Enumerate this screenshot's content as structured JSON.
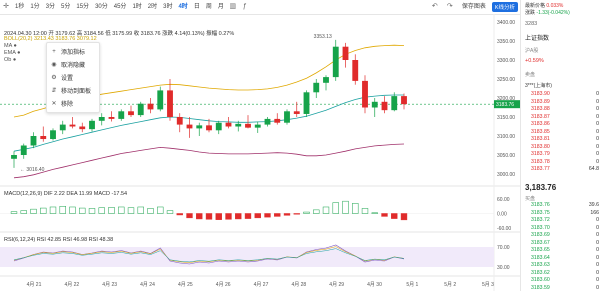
{
  "toolbar": {
    "timeframes": [
      "1秒",
      "1分",
      "3分",
      "5分",
      "15分",
      "30分",
      "45分",
      "1时",
      "2时",
      "3时",
      "4时",
      "日",
      "周",
      "月"
    ],
    "active_index": 10,
    "right_label": "保存图表",
    "badge": "K线分析"
  },
  "legend": {
    "line1": "2024.04.30 12:00  开 3179.62  高 3184.56  低 3175.99  收 3183.76  涨跌 4.14(0.13%)  振幅 0.27%",
    "line2": "BOLL(20,2)  3213.43  3183.76  3079.12"
  },
  "context_menu": {
    "items": [
      {
        "label": "添加指标",
        "icon": "plus-icon",
        "glyph": "+"
      },
      {
        "label": "取消隐藏",
        "icon": "eye-icon",
        "glyph": "◉"
      },
      {
        "label": "设置",
        "icon": "gear-icon",
        "glyph": "⚙"
      },
      {
        "label": "移动到面板",
        "icon": "move-icon",
        "glyph": "⇵"
      },
      {
        "label": "移除",
        "icon": "trash-icon",
        "glyph": "✕"
      }
    ]
  },
  "chart_labels": {
    "high_marker": "3353.13",
    "low_marker": "3016.40",
    "price_tag": "3183.76",
    "macd_title": "MACD(12,26,9)  DIF 2.22  DEA 11.99  MACD -17.54",
    "rsi_title": "RSI(6,12,24)  RSI 42.85  RSI 46.98  RSI 48.38"
  },
  "price_axis": [
    "3400.00",
    "3350.00",
    "3300.00",
    "3250.00",
    "3200.00",
    "3150.00",
    "3100.00",
    "3050.00",
    "3000.00"
  ],
  "macd_axis": [
    "60.00",
    "0.00",
    "-60.00"
  ],
  "rsi_axis": [
    "70.00",
    "30.00"
  ],
  "date_axis": [
    "4月 21",
    "4月 22",
    "4月 23",
    "4月 24",
    "4月 25",
    "4月 26",
    "4月 27",
    "4月 28",
    "4月 29",
    "4月 30",
    "5月 1",
    "5月 2",
    "5月 3"
  ],
  "chart_data": {
    "type": "candlestick",
    "candles": [
      {
        "o": 3040,
        "h": 3060,
        "l": 3016,
        "c": 3050
      },
      {
        "o": 3050,
        "h": 3080,
        "l": 3040,
        "c": 3075
      },
      {
        "o": 3075,
        "h": 3110,
        "l": 3068,
        "c": 3100
      },
      {
        "o": 3100,
        "h": 3125,
        "l": 3085,
        "c": 3092
      },
      {
        "o": 3092,
        "h": 3120,
        "l": 3088,
        "c": 3115
      },
      {
        "o": 3115,
        "h": 3140,
        "l": 3105,
        "c": 3130
      },
      {
        "o": 3130,
        "h": 3150,
        "l": 3120,
        "c": 3125
      },
      {
        "o": 3125,
        "h": 3135,
        "l": 3110,
        "c": 3118
      },
      {
        "o": 3118,
        "h": 3145,
        "l": 3112,
        "c": 3140
      },
      {
        "o": 3140,
        "h": 3160,
        "l": 3128,
        "c": 3150
      },
      {
        "o": 3150,
        "h": 3165,
        "l": 3138,
        "c": 3145
      },
      {
        "o": 3145,
        "h": 3170,
        "l": 3140,
        "c": 3165
      },
      {
        "o": 3165,
        "h": 3180,
        "l": 3150,
        "c": 3155
      },
      {
        "o": 3155,
        "h": 3190,
        "l": 3150,
        "c": 3185
      },
      {
        "o": 3185,
        "h": 3200,
        "l": 3160,
        "c": 3170
      },
      {
        "o": 3170,
        "h": 3230,
        "l": 3165,
        "c": 3220
      },
      {
        "o": 3220,
        "h": 3250,
        "l": 3140,
        "c": 3150
      },
      {
        "o": 3150,
        "h": 3160,
        "l": 3110,
        "c": 3130
      },
      {
        "o": 3130,
        "h": 3150,
        "l": 3095,
        "c": 3120
      },
      {
        "o": 3120,
        "h": 3135,
        "l": 3100,
        "c": 3128
      },
      {
        "o": 3128,
        "h": 3145,
        "l": 3110,
        "c": 3115
      },
      {
        "o": 3115,
        "h": 3140,
        "l": 3105,
        "c": 3135
      },
      {
        "o": 3135,
        "h": 3150,
        "l": 3120,
        "c": 3125
      },
      {
        "o": 3125,
        "h": 3140,
        "l": 3112,
        "c": 3132
      },
      {
        "o": 3132,
        "h": 3155,
        "l": 3120,
        "c": 3122
      },
      {
        "o": 3122,
        "h": 3138,
        "l": 3108,
        "c": 3130
      },
      {
        "o": 3130,
        "h": 3150,
        "l": 3125,
        "c": 3145
      },
      {
        "o": 3145,
        "h": 3160,
        "l": 3130,
        "c": 3135
      },
      {
        "o": 3135,
        "h": 3170,
        "l": 3130,
        "c": 3165
      },
      {
        "o": 3165,
        "h": 3190,
        "l": 3150,
        "c": 3158
      },
      {
        "o": 3158,
        "h": 3220,
        "l": 3150,
        "c": 3215
      },
      {
        "o": 3215,
        "h": 3250,
        "l": 3200,
        "c": 3240
      },
      {
        "o": 3240,
        "h": 3260,
        "l": 3220,
        "c": 3255
      },
      {
        "o": 3255,
        "h": 3353,
        "l": 3245,
        "c": 3335
      },
      {
        "o": 3335,
        "h": 3345,
        "l": 3280,
        "c": 3300
      },
      {
        "o": 3300,
        "h": 3315,
        "l": 3235,
        "c": 3245
      },
      {
        "o": 3245,
        "h": 3260,
        "l": 3160,
        "c": 3175
      },
      {
        "o": 3175,
        "h": 3200,
        "l": 3150,
        "c": 3190
      },
      {
        "o": 3190,
        "h": 3205,
        "l": 3160,
        "c": 3168
      },
      {
        "o": 3168,
        "h": 3215,
        "l": 3165,
        "c": 3205
      },
      {
        "o": 3205,
        "h": 3212,
        "l": 3170,
        "c": 3183.76
      }
    ],
    "boll_upper": [
      3150,
      3155,
      3165,
      3172,
      3180,
      3188,
      3195,
      3200,
      3205,
      3210,
      3214,
      3218,
      3222,
      3226,
      3230,
      3234,
      3236,
      3235,
      3232,
      3229,
      3226,
      3224,
      3222,
      3221,
      3221,
      3222,
      3224,
      3228,
      3234,
      3242,
      3252,
      3266,
      3282,
      3300,
      3315,
      3325,
      3332,
      3336,
      3338,
      3339,
      3338
    ],
    "boll_mid": [
      3060,
      3065,
      3070,
      3078,
      3085,
      3092,
      3098,
      3104,
      3110,
      3116,
      3122,
      3128,
      3133,
      3138,
      3143,
      3148,
      3150,
      3149,
      3146,
      3143,
      3140,
      3138,
      3137,
      3136,
      3136,
      3137,
      3138,
      3140,
      3143,
      3147,
      3152,
      3160,
      3168,
      3178,
      3188,
      3196,
      3202,
      3205,
      3207,
      3208,
      3208
    ],
    "boll_lower": [
      2990,
      2993,
      2998,
      3005,
      3012,
      3018,
      3024,
      3030,
      3036,
      3042,
      3048,
      3054,
      3058,
      3062,
      3066,
      3070,
      3068,
      3065,
      3062,
      3058,
      3055,
      3054,
      3053,
      3053,
      3053,
      3054,
      3055,
      3056,
      3055,
      3052,
      3048,
      3048,
      3050,
      3055,
      3060,
      3066,
      3070,
      3074,
      3076,
      3078,
      3079
    ],
    "macd_hist": [
      5,
      8,
      12,
      15,
      18,
      20,
      18,
      15,
      14,
      16,
      17,
      18,
      16,
      18,
      14,
      18,
      8,
      -4,
      -12,
      -15,
      -16,
      -17,
      -16,
      -15,
      -14,
      -12,
      -10,
      -8,
      -5,
      -2,
      4,
      10,
      18,
      30,
      34,
      28,
      14,
      2,
      -8,
      -14,
      -17.54
    ],
    "rsi_level": [
      42,
      48,
      55,
      60,
      58,
      62,
      60,
      55,
      58,
      62,
      60,
      63,
      58,
      62,
      57,
      68,
      42,
      38,
      36,
      40,
      38,
      42,
      40,
      42,
      40,
      42,
      46,
      44,
      50,
      48,
      60,
      65,
      68,
      74,
      62,
      52,
      40,
      44,
      42,
      50,
      46
    ]
  },
  "panel": {
    "ticker": "3283",
    "title": "上证指数",
    "sub1": "最新价格",
    "sub1_val": "0.033%",
    "sub2": "涨跌",
    "sub2_val": "-1.33(-0.042%)",
    "tag1": "沪A股",
    "tag2": "上证指数",
    "change": "+0.59%",
    "ask_header": "卖盘",
    "bid_header": "买盘",
    "book_label": "3***(上海市)",
    "current": "3,183.76",
    "asks": [
      {
        "p": "3183.90",
        "v": "0"
      },
      {
        "p": "3183.89",
        "v": "0"
      },
      {
        "p": "3183.88",
        "v": "0"
      },
      {
        "p": "3183.87",
        "v": "0"
      },
      {
        "p": "3183.86",
        "v": "0"
      },
      {
        "p": "3183.85",
        "v": "0"
      },
      {
        "p": "3183.81",
        "v": "0"
      },
      {
        "p": "3183.80",
        "v": "0"
      },
      {
        "p": "3183.79",
        "v": "0"
      },
      {
        "p": "3183.78",
        "v": "0"
      },
      {
        "p": "3183.77",
        "v": "64.8"
      }
    ],
    "bids": [
      {
        "p": "3183.76",
        "v": "39.6"
      },
      {
        "p": "3183.75",
        "v": "166"
      },
      {
        "p": "3183.72",
        "v": "0"
      },
      {
        "p": "3183.70",
        "v": "0"
      },
      {
        "p": "3183.69",
        "v": "0"
      },
      {
        "p": "3183.67",
        "v": "0"
      },
      {
        "p": "3183.65",
        "v": "0"
      },
      {
        "p": "3183.64",
        "v": "0"
      },
      {
        "p": "3183.63",
        "v": "0"
      },
      {
        "p": "3183.62",
        "v": "0"
      },
      {
        "p": "3183.60",
        "v": "0"
      },
      {
        "p": "3183.59",
        "v": "0"
      }
    ]
  }
}
